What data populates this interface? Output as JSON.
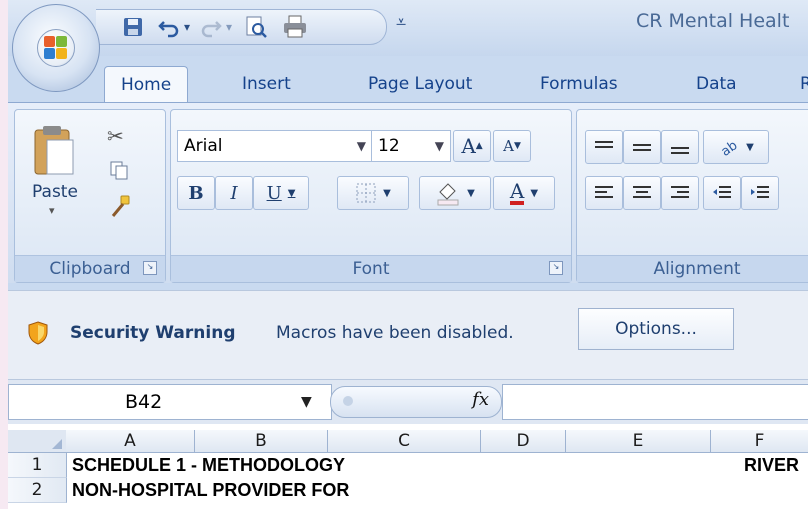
{
  "title": "CR  Mental Healt",
  "tabs": [
    {
      "label": "Home"
    },
    {
      "label": "Insert"
    },
    {
      "label": "Page Layout"
    },
    {
      "label": "Formulas"
    },
    {
      "label": "Data"
    },
    {
      "label": "R"
    }
  ],
  "ribbon": {
    "clipboard": {
      "label": "Clipboard",
      "paste_label": "Paste"
    },
    "font": {
      "label": "Font",
      "font_name": "Arial",
      "font_size": "12",
      "grow_label": "A",
      "shrink_label": "A",
      "bold": "B",
      "italic": "I",
      "underline": "U",
      "color_letter": "A"
    },
    "alignment": {
      "label": "Alignment"
    }
  },
  "security": {
    "title": "Security Warning",
    "message": "Macros have been disabled.",
    "options_label": "Options..."
  },
  "formula_bar": {
    "name_box": "B42",
    "fx": "fx"
  },
  "grid": {
    "columns": [
      "A",
      "B",
      "C",
      "D",
      "E",
      "F"
    ],
    "rows": [
      {
        "num": "1",
        "a": "SCHEDULE 1  -  METHODOLOGY",
        "f": "RIVER"
      },
      {
        "num": "2",
        "a": "NON-HOSPITAL PROVIDER FOR",
        "f": ""
      }
    ]
  },
  "colors": {
    "accent": "#15428b",
    "ribbon": "#dbe6f4",
    "highlight": "#f6e9f2"
  }
}
